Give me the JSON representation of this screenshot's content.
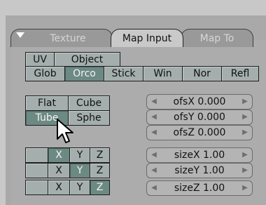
{
  "tabs": [
    {
      "label": "Texture",
      "active": false
    },
    {
      "label": "Map Input",
      "active": true
    },
    {
      "label": "Map To",
      "active": false
    }
  ],
  "coord_row1": [
    {
      "label": "UV",
      "active": false
    },
    {
      "label": "Object",
      "active": false
    }
  ],
  "coord_row2": [
    {
      "label": "Glob",
      "active": false
    },
    {
      "label": "Orco",
      "active": true
    },
    {
      "label": "Stick",
      "active": false
    },
    {
      "label": "Win",
      "active": false
    },
    {
      "label": "Nor",
      "active": false
    },
    {
      "label": "Refl",
      "active": false
    }
  ],
  "projection": {
    "flat": "Flat",
    "cube": "Cube",
    "tube": "Tube",
    "sphe": "Sphe",
    "selected": "Tube"
  },
  "offset": {
    "x": {
      "label": "ofsX",
      "value": "0.000"
    },
    "y": {
      "label": "ofsY",
      "value": "0.000"
    },
    "z": {
      "label": "ofsZ",
      "value": "0.000"
    }
  },
  "size": {
    "x": {
      "label": "sizeX",
      "value": "1.00"
    },
    "y": {
      "label": "sizeY",
      "value": "1.00"
    },
    "z": {
      "label": "sizeZ",
      "value": "1.00"
    }
  },
  "axis_mapping": {
    "labels": [
      "X",
      "Y",
      "Z"
    ],
    "rows": [
      {
        "active": "X"
      },
      {
        "active": "Y"
      },
      {
        "active": "Z"
      }
    ]
  },
  "colors": {
    "button_off": "#a4afad",
    "button_on": "#6d8984",
    "panel": "#acacac"
  }
}
